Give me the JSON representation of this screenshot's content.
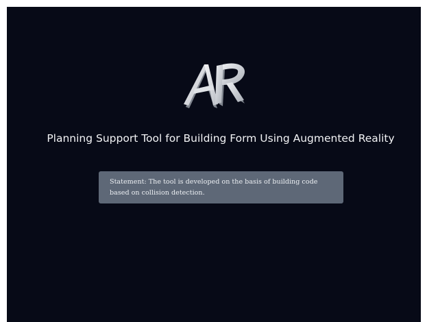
{
  "app": {
    "title": "Planning Support Tool for Building Form Using Augmented Reality",
    "logo": {
      "text": "AR",
      "icon": "ar-3d-letters-icon"
    },
    "statement": "Statement: The tool is developed on the basis of building code based on collision detection."
  },
  "colors": {
    "background": "#070a17",
    "title_text": "#f2f3f5",
    "statement_box": "#5e6877",
    "statement_text": "#eceff3",
    "logo_light": "#e6e8ec",
    "logo_shadow": "#8f949c"
  }
}
